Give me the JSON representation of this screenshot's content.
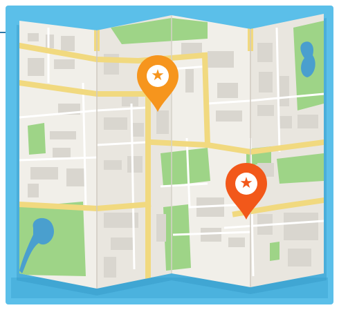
{
  "colors": {
    "frame": "#5bbfe9",
    "paper": "#f1efe9",
    "paper_shade": "#e4e1da",
    "road": "#f1d97f",
    "street": "#ffffff",
    "block": "#d9d6cf",
    "park": "#9ed487",
    "park_dark": "#7fc46e",
    "water": "#4a9fce",
    "pin_orange": "#f6951d",
    "pin_red": "#f2581a",
    "star_orange": "#f6951d",
    "star_red": "#f2581a"
  },
  "markers": [
    {
      "id": "marker-top",
      "icon": "star-icon",
      "color": "pin_orange"
    },
    {
      "id": "marker-right",
      "icon": "star-icon",
      "color": "pin_red"
    }
  ]
}
